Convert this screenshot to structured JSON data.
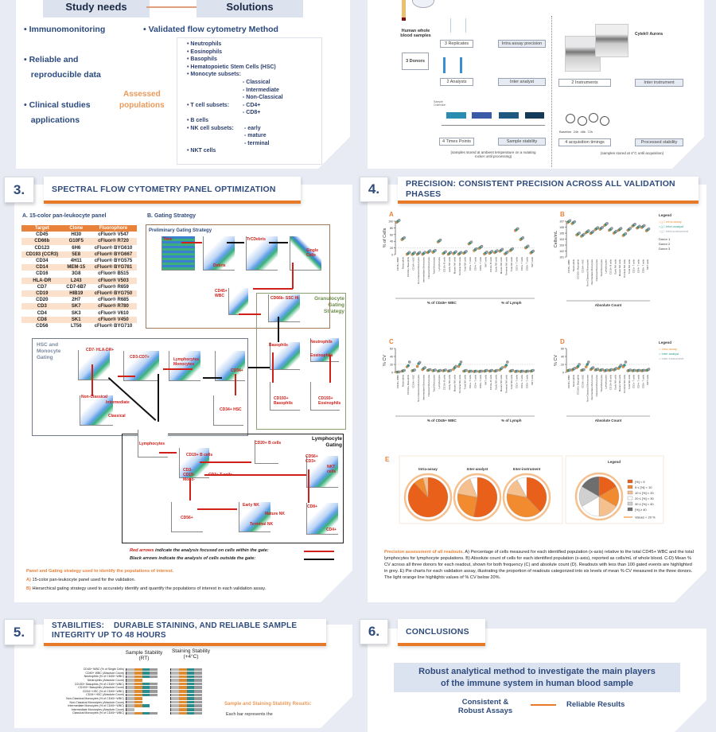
{
  "s1": {
    "study_needs": "Study needs",
    "solutions": "Solutions",
    "needs": [
      "Immunomonitoring",
      "Reliable and",
      "reproducible data",
      "Clinical studies",
      "applications"
    ],
    "method": "Validated flow cytometry Method",
    "assessed": [
      "Assessed",
      "populations"
    ],
    "populations": [
      "Neutrophils",
      "Eosinophils",
      "Basophils",
      "Hematopoietic Stem Cells (HSC)",
      "Monocyte subsets:",
      "T cell subsets:",
      "B cells",
      "NK cell subsets:",
      "NKT cells"
    ],
    "monocyte_sub": [
      "- Classical",
      "- Intermediate",
      "- Non-Classical"
    ],
    "t_sub": [
      "- CD4+",
      "- CD8+"
    ],
    "nk_sub": [
      "- early",
      "- mature",
      "- terminal"
    ]
  },
  "s2": {
    "blood": "Human whole blood samples",
    "donors": "3 Donors",
    "replicates": "3 Replicates",
    "intra": "Intra assay precision",
    "analysts": "2 Analysts",
    "inter_analyst": "Inter analyst",
    "sample_collection": "Sample Collection",
    "timepoints": "4 Times Points",
    "sample_stability": "Sample stability",
    "note_left": "(samples stored at ambient temperature on a nutating rocker until processing)",
    "cytek": "Cytek® Aurora",
    "instruments": "2 Instruments",
    "inter_instrument": "Inter instrument",
    "timings_labels": "Baseline  24h  48h  72h",
    "timings": "4 acquisition timings",
    "processed": "Processed stability",
    "note_right": "(samples stored at 4°C until acquisition)"
  },
  "s3": {
    "num": "3.",
    "title": "SPECTRAL FLOW CYTOMETRY PANEL OPTIMIZATION",
    "a_label": "A. 15-color pan-leukocyte panel",
    "b_label": "B. Gating Strategy",
    "table_headers": [
      "Target",
      "Clone",
      "Fluorophore"
    ],
    "table_rows": [
      [
        "CD45",
        "HI30",
        "cFluor® V547"
      ],
      [
        "CD66b",
        "G10F5",
        "cFluor® R720"
      ],
      [
        "CD123",
        "6H6",
        "cFluor® BYG610"
      ],
      [
        "CD193 (CCR3)",
        "5E8",
        "cFluor® BYG667"
      ],
      [
        "CD34",
        "4H11",
        "cFluor® BYG575"
      ],
      [
        "CD14",
        "MEM-15",
        "cFluor® BYG781"
      ],
      [
        "CD16",
        "3G8",
        "cFluor® B515"
      ],
      [
        "HLA-DR",
        "L243",
        "cFluor® V503"
      ],
      [
        "CD7",
        "CD7-6B7",
        "cFluor® R659"
      ],
      [
        "CD19",
        "HIB19",
        "cFluor® BYG750"
      ],
      [
        "CD20",
        "2H7",
        "cFluor® R685"
      ],
      [
        "CD3",
        "SK7",
        "cFluor® R780"
      ],
      [
        "CD4",
        "SK3",
        "cFluor® V610"
      ],
      [
        "CD8",
        "SK1",
        "cFluor® V450"
      ],
      [
        "CD56",
        "LT56",
        "cFluor® BYG710"
      ]
    ],
    "prelim": "Preliminary Gating Strategy",
    "gran": "Granulocyte Gating Strategy",
    "hsc": "HSC and Monocyte Gating",
    "lymph": "Lymphocyte Gating",
    "gates": {
      "time": "Time",
      "debris": "Debris",
      "tcd": "TrCDebris",
      "single": "Single Cells",
      "wbc": "CD45+ WBC",
      "ssc": "CD66b- SSC Hi",
      "neut": "Neutrophils",
      "eos": "Eosinophils",
      "baso": "Basophils",
      "cd193b": "CD193+ Basophils",
      "cd193e": "CD193+ Eosinophils",
      "cd7": "CD7- HLA-DR+",
      "cd3cd7": "CD3-CD7+",
      "lm": "Lymphocytes Monocytes",
      "cd34": "CD34+",
      "hscg": "CD34+ HSC",
      "nonc": "Non-Classical",
      "inter": "Intermediate",
      "clas": "Classical",
      "lymphs": "Lymphocytes",
      "cd19": "CD19+ B cells",
      "cd20": "CD20+ B cells",
      "cd3neg": "CD3- CD19- Mono-",
      "cd3t": "CD3+ T cells",
      "nkt": "NKT cells",
      "cd56": "CD56+ CD3+",
      "cd56p": "CD56+",
      "early": "Early NK",
      "mature": "Mature NK",
      "terminal": "Terminal NK",
      "cd8": "CD8+",
      "cd4": "CD4+"
    },
    "red_legend_em": "Red arrows",
    "red_legend": " indicate the analysis focused on cells within the gate:",
    "black_legend_em": "Black arrows",
    "black_legend": " indicate the analysis of cells outside the gate:",
    "caption_title": "Panel and Gating strategy used to identify the populations of interest.",
    "caption_a_key": "A)",
    "caption_a": " 15-color pan-leukocyte panel used for the validation.",
    "caption_b_key": "B)",
    "caption_b": " Hierarchical gating strategy used to accurately identify and quantify the populations of interest in each validation assay."
  },
  "s4": {
    "num": "4.",
    "title": "PRECISION: CONSISTENT PRECISION ACROSS ALL VALIDATION PHASES",
    "legend_title": "Legend",
    "legend_ab": [
      "Intra-assay",
      "Inter-analyst",
      "Inter-instrument",
      "Donor 1",
      "Donor 2",
      "Donor 3"
    ],
    "legend_cd": [
      "Intra assay",
      "Inter analyst",
      "Inter instrument"
    ],
    "group_wbc": "% of CD45+ WBC",
    "group_lymph": "% of Lymph",
    "group_abs": "Absolute Count",
    "caption_title": "Precision assessment of all readouts.",
    "caption": " A) Percentage of cells measured for each identified population (x-axis) relative to the total CD45+ WBC and the total lymphocytes for lymphocyte populations. B) Absolute count of cells for each identified population (x-axis), reported as cells/mL of whole blood. C-D) Mean % CV across all three donors for each readout, shown for both frequency (C) and absolute count (D). Readouts with less than 100 gated events are highlighted in grey. E) Pie charts for each validation assay, illustrating the proportion of readouts categorized into six levels of mean % CV measured in the three donors. The light orange line highlights values of % CV below 20%."
  },
  "chart_data": [
    {
      "panel": "A",
      "type": "scatter",
      "ylabel": "% of Cells",
      "ylim": [
        0,
        100
      ],
      "categories": [
        "CD45+ WBC",
        "Neutrophils",
        "CD193+ Basophils",
        "CD34+ HSC",
        "Non-Classical Monocytes",
        "Intermediate Monocytes",
        "Classical Monocytes",
        "Total Monocytes",
        "Lymphocytes",
        "CD19+ B cells",
        "Early NK cells",
        "Mature NK cells",
        "Terminal NK cells",
        "Total NK cells",
        "CD3+ T cells",
        "CD4+ T cells",
        "CD8+ T cells",
        "NKT cells",
        "CD19+ B cells ",
        "Early NK cells ",
        "Mature NK cells ",
        "Terminal NK cells ",
        "Total NK cells ",
        "CD3+ T cells ",
        "CD4+ T cells ",
        "CD8+ T cells ",
        "NKT cells "
      ],
      "values": [
        97,
        45,
        1,
        0.5,
        1,
        1,
        6,
        7,
        38,
        3,
        1,
        3,
        1,
        4,
        32,
        12,
        19,
        2,
        4,
        6,
        10,
        2,
        12,
        72,
        45,
        20,
        5
      ]
    },
    {
      "panel": "B",
      "type": "scatter",
      "ylabel": "Cells/mL",
      "yscale": "log",
      "ylim": [
        10,
        10000000
      ],
      "categories": [
        "CD45+ WBC",
        "Neutrophils",
        "CD193+ Basophils",
        "CD34+ HSC",
        "Non-Classical Monocytes",
        "Intermediate Monocytes",
        "Classical Monocytes",
        "Total Monocytes",
        "Lymphocytes",
        "CD19+ B cells",
        "Early NK cells",
        "Mature NK cells",
        "Terminal NK cells",
        "Total NK cells",
        "CD3+ T cells",
        "CD4+ T cells",
        "CD8+ T cells",
        "NKT cells"
      ],
      "values": [
        6000000,
        4000000,
        50000,
        30000,
        120000,
        90000,
        400000,
        450000,
        2000000,
        300000,
        100000,
        300000,
        40000,
        300000,
        1500000,
        700000,
        900000,
        250000
      ]
    },
    {
      "panel": "C",
      "type": "scatter",
      "ylabel": "% CV",
      "ylim": [
        0,
        60
      ],
      "categories": [
        "CD45+ WBC",
        "Neutrophils",
        "CD193+ Basophils",
        "CD34+ HSC",
        "Non-Classical Monocytes",
        "Intermediate Monocytes",
        "Classical Monocytes",
        "Total Monocytes",
        "Lymphocytes",
        "CD19+ B cells",
        "Early NK cells",
        "Mature NK cells",
        "Terminal NK cells",
        "Total NK cells",
        "CD3+ T cells",
        "CD4+ T cells",
        "CD8+ T cells",
        "NKT cells",
        "CD19+ B cells ",
        "Early NK cells ",
        "Mature NK cells ",
        "Terminal NK cells ",
        "Total NK cells ",
        "CD3+ T cells ",
        "CD4+ T cells ",
        "CD8+ T cells ",
        "NKT cells "
      ],
      "series": [
        {
          "name": "Intra assay",
          "values": [
            0.5,
            3,
            14,
            4,
            15,
            7,
            5,
            4,
            3,
            4,
            3,
            8,
            15,
            3,
            2,
            2,
            2,
            3,
            3,
            3,
            6,
            14,
            3,
            2,
            2,
            2,
            3
          ]
        },
        {
          "name": "Inter analyst",
          "values": [
            1,
            4,
            17,
            5,
            22,
            10,
            6,
            5,
            4,
            5,
            4,
            12,
            20,
            4,
            3,
            3,
            3,
            4,
            4,
            4,
            9,
            18,
            4,
            3,
            3,
            3,
            4
          ]
        },
        {
          "name": "Inter instrument",
          "values": [
            1,
            5,
            26,
            6,
            25,
            12,
            7,
            6,
            5,
            6,
            5,
            15,
            26,
            5,
            3,
            3,
            3,
            5,
            5,
            5,
            12,
            26,
            5,
            3,
            3,
            3,
            5
          ]
        }
      ]
    },
    {
      "panel": "D",
      "type": "scatter",
      "ylabel": "% CV",
      "ylim": [
        0,
        60
      ],
      "categories": [
        "CD45+ WBC",
        "Neutrophils",
        "CD193+ Basophils",
        "CD34+ HSC",
        "Non-Classical Monocytes",
        "Intermediate Monocytes",
        "Classical Monocytes",
        "Total Monocytes",
        "Lymphocytes",
        "CD19+ B cells",
        "Early NK cells",
        "Mature NK cells",
        "Terminal NK cells",
        "Total NK cells",
        "CD3+ T cells",
        "CD4+ T cells",
        "CD8+ T cells",
        "NKT cells"
      ],
      "series": [
        {
          "name": "Intra assay",
          "values": [
            4,
            6,
            12,
            5,
            14,
            7,
            6,
            5,
            4,
            5,
            6,
            10,
            14,
            4,
            4,
            4,
            4,
            5
          ]
        },
        {
          "name": "Inter analyst",
          "values": [
            5,
            8,
            15,
            6,
            20,
            10,
            7,
            6,
            5,
            6,
            8,
            14,
            18,
            5,
            5,
            5,
            5,
            6
          ]
        },
        {
          "name": "Inter instrument",
          "values": [
            6,
            10,
            20,
            7,
            26,
            12,
            8,
            7,
            6,
            7,
            10,
            18,
            26,
            6,
            5,
            5,
            5,
            8
          ]
        }
      ]
    },
    {
      "panel": "E",
      "type": "pie",
      "categories": [
        "[%] < 5",
        "5 ≤ [%] < 10",
        "10 ≤ [%] < 20",
        "20 ≤ [%] < 30",
        "30 ≤ [%] < 40",
        "[%] ≥ 40"
      ],
      "extra_legend": "Values < 20 %",
      "colors": [
        "#e8601a",
        "#f28a30",
        "#f6c08e",
        "#ffffff",
        "#d0d0d0",
        "#6e6e6e"
      ],
      "pies": [
        {
          "name": "Intra-assay",
          "values": [
            88,
            8,
            4,
            0,
            0,
            0
          ]
        },
        {
          "name": "Inter-analyst",
          "values": [
            53,
            25,
            16,
            6,
            0,
            0
          ]
        },
        {
          "name": "Inter-instrument",
          "values": [
            38,
            40,
            14,
            8,
            0,
            0
          ]
        }
      ],
      "legend_name": "Legend"
    }
  ],
  "s5": {
    "num": "5.",
    "title1": "STABILITIES:    DURABLE STAINING, AND RELIABLE SAMPLE",
    "title2": "INTEGRITY UP TO 48 HOURS",
    "col1": "Sample Stability (RT)",
    "col2": "Staining Stability (+4°C)",
    "rows": [
      "CD45+ WBC (% of Single Cells)",
      "CD45+ WBC (Absolute Count)",
      "Neutrophils (% of CD45+ WBC)",
      "Neutrophils (Absolute Count)",
      "CD193+ Basophils (% of CD45+ WBC)",
      "CD193+ Basophils (Absolute Count)",
      "CD34+ HSC (% of CD45+ WBC)",
      "CD34+ HSC (Absolute Count)",
      "Non-Classical Monocytes (% of CD45+ WBC)",
      "Non-Classical Monocytes (Absolute Count)",
      "Intermediate Monocytes (% of CD45+ WBC)",
      "Intermediate Monocytes (Absolute Count)",
      "Classical Monocytes (% of CD45+ WBC)"
    ],
    "sample_segments": [
      4,
      4,
      4,
      2,
      4,
      4,
      4,
      4,
      2,
      2,
      3,
      1,
      4
    ],
    "results_title": "Sample and Staining Stability Results:",
    "results_text": "Each bar represents the"
  },
  "s6": {
    "num": "6.",
    "title": "CONCLUSIONS",
    "banner": "Robust analytical method to investigate the main players of the immune system in human blood sample",
    "left": "Consistent & Robust Assays",
    "right": "Reliable Results"
  },
  "colors": {
    "accent": "#e67a28",
    "navy": "#2f4b7c",
    "teal": "#2a8c8c",
    "red": "#d0201a"
  }
}
